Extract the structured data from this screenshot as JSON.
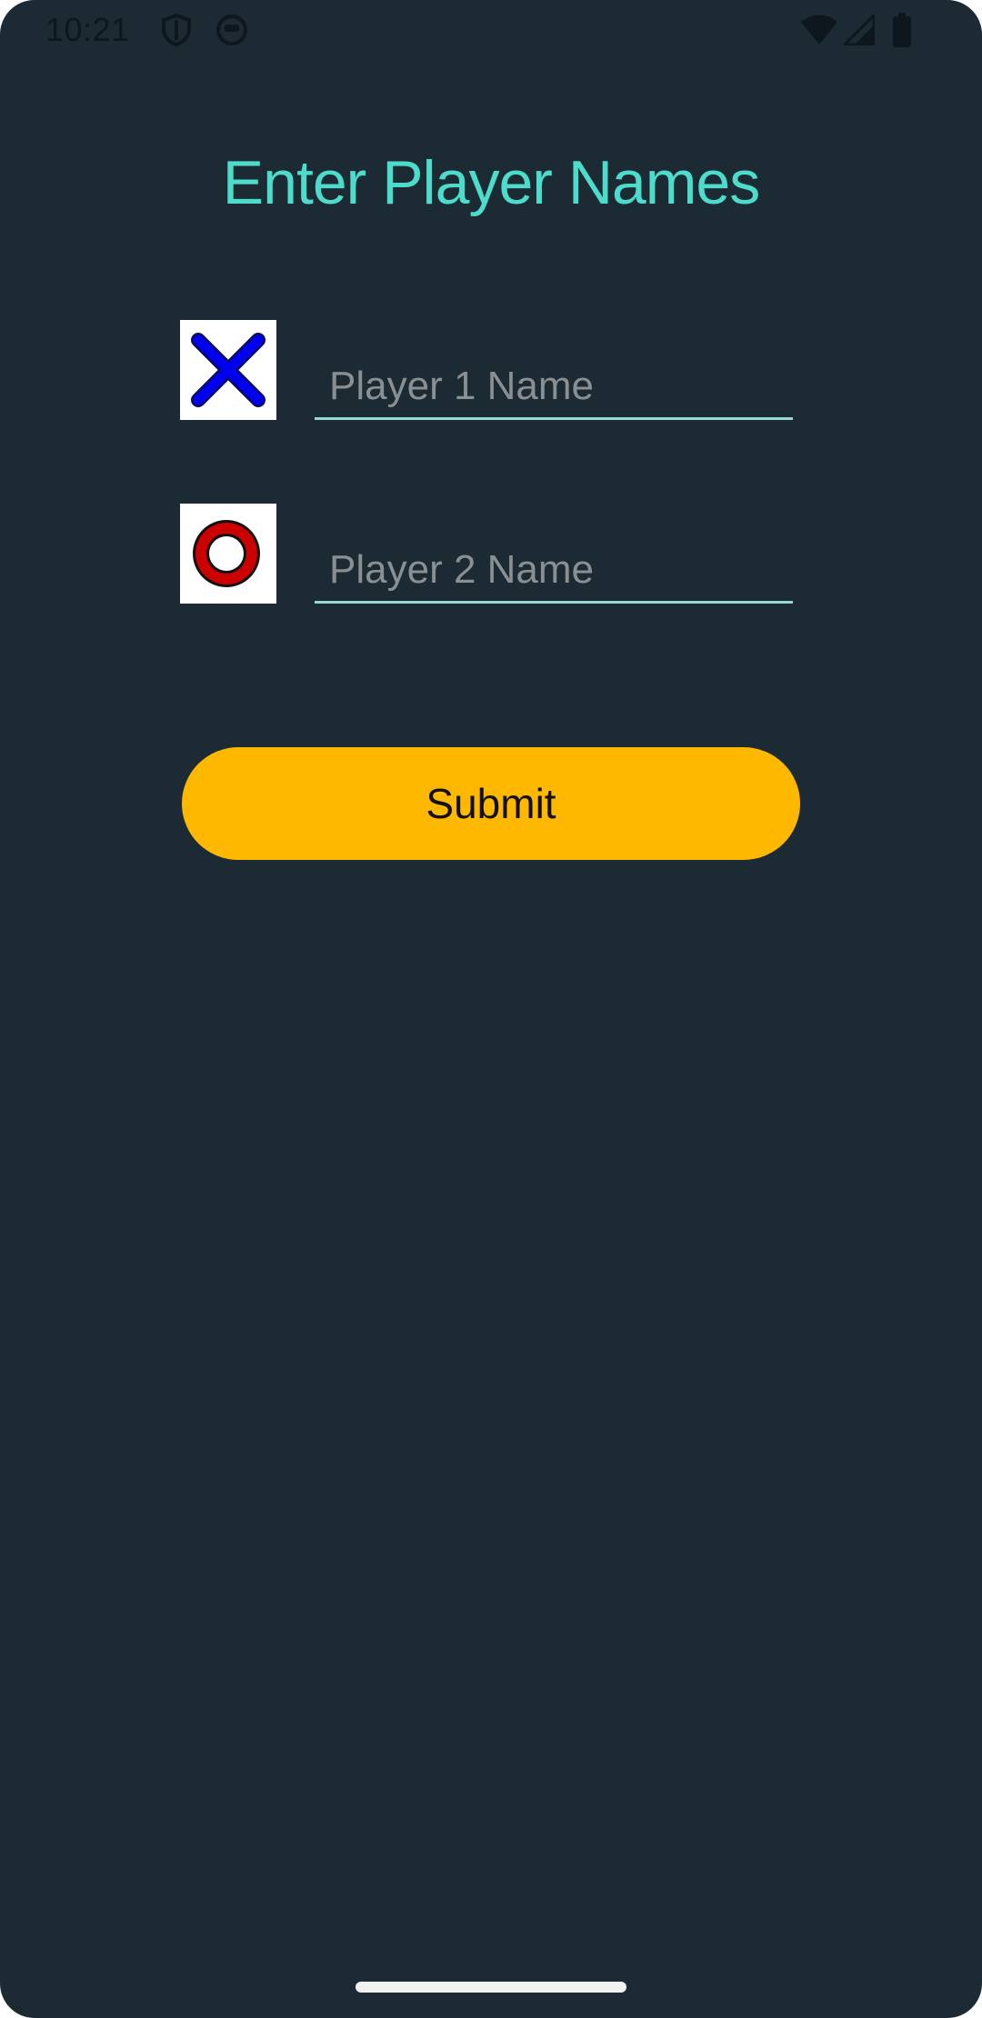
{
  "status_bar": {
    "time": "10:21",
    "icons_left": [
      "shield-icon",
      "notification-face-icon"
    ],
    "icons_right": [
      "wifi-icon",
      "cell-signal-icon",
      "battery-icon"
    ]
  },
  "screen": {
    "title": "Enter Player Names",
    "background_color": "#1b2a33",
    "title_color": "#4ddccb"
  },
  "players": [
    {
      "symbol": "x-mark-icon",
      "symbol_color": "#0000ee",
      "placeholder": "Player 1 Name",
      "value": ""
    },
    {
      "symbol": "o-ring-icon",
      "symbol_color": "#cc0000",
      "placeholder": "Player 2 Name",
      "value": ""
    }
  ],
  "submit": {
    "label": "Submit",
    "color": "#ffb800"
  }
}
